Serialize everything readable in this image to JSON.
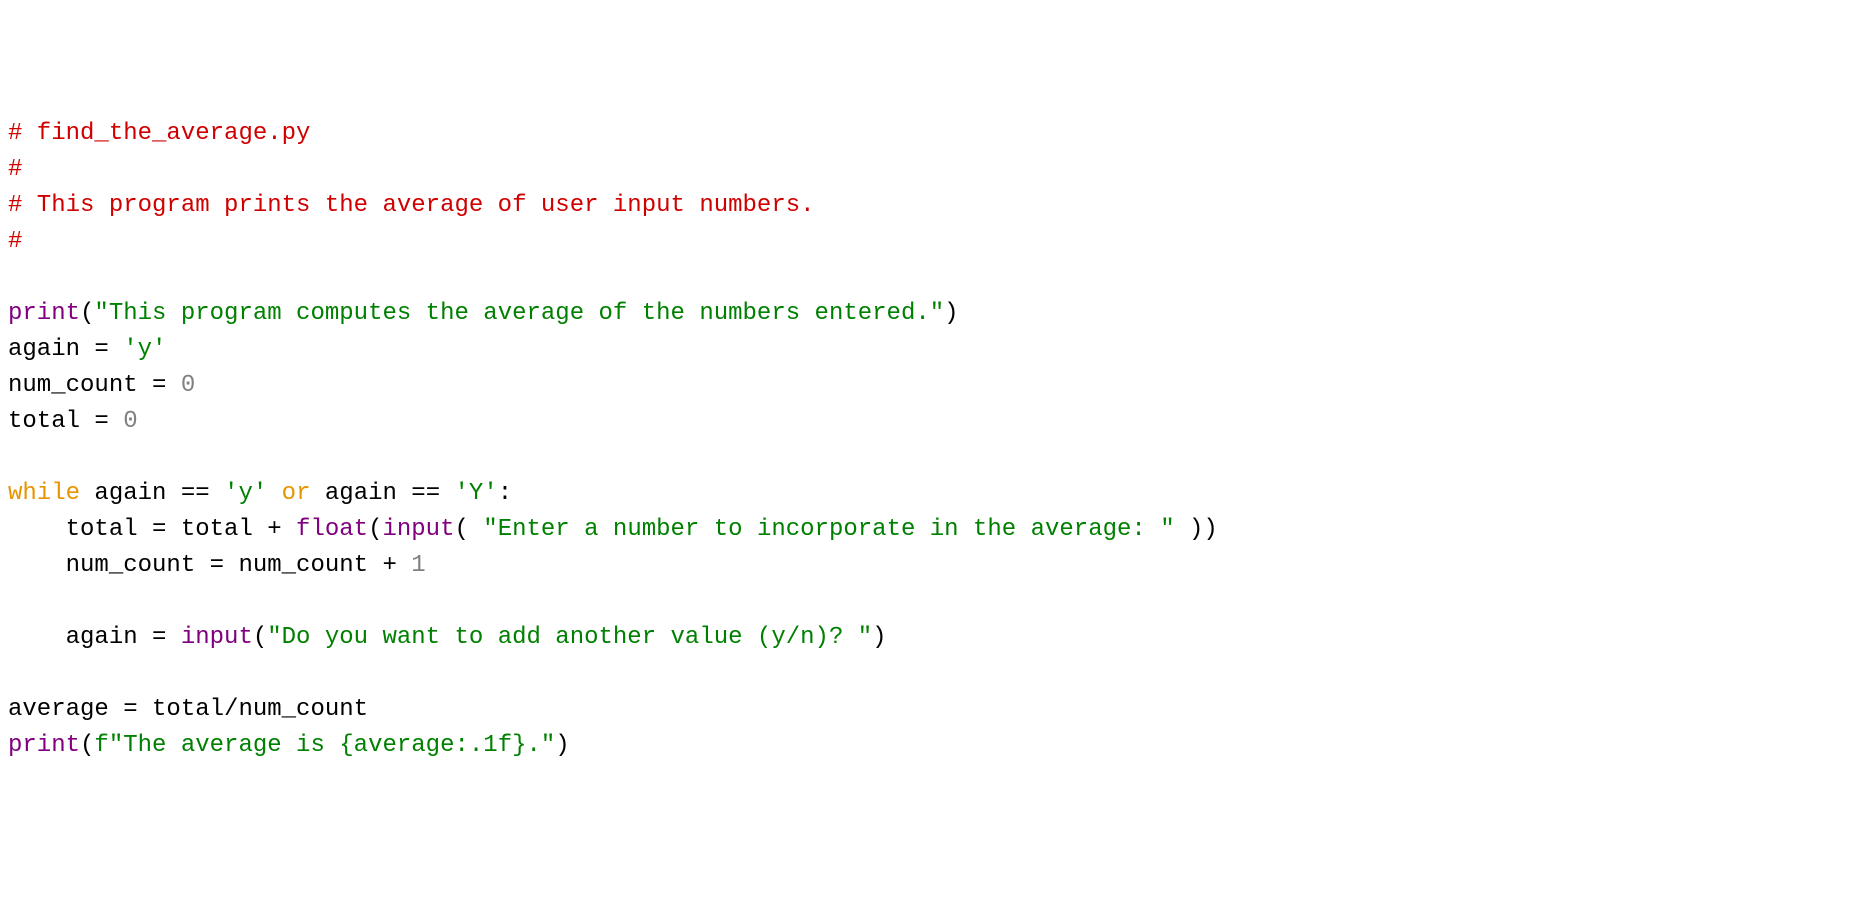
{
  "code": {
    "lines": [
      [
        {
          "cls": "c-comment",
          "text": "# find_the_average.py"
        }
      ],
      [
        {
          "cls": "c-comment",
          "text": "#"
        }
      ],
      [
        {
          "cls": "c-comment",
          "text": "# This program prints the average of user input numbers."
        }
      ],
      [
        {
          "cls": "c-comment",
          "text": "#"
        }
      ],
      [
        {
          "cls": "c-default",
          "text": ""
        }
      ],
      [
        {
          "cls": "c-builtin",
          "text": "print"
        },
        {
          "cls": "c-default",
          "text": "("
        },
        {
          "cls": "c-string",
          "text": "\"This program computes the average of the numbers entered.\""
        },
        {
          "cls": "c-default",
          "text": ")"
        }
      ],
      [
        {
          "cls": "c-default",
          "text": "again = "
        },
        {
          "cls": "c-string",
          "text": "'y'"
        }
      ],
      [
        {
          "cls": "c-default",
          "text": "num_count = "
        },
        {
          "cls": "c-number",
          "text": "0"
        }
      ],
      [
        {
          "cls": "c-default",
          "text": "total = "
        },
        {
          "cls": "c-number",
          "text": "0"
        }
      ],
      [
        {
          "cls": "c-default",
          "text": ""
        }
      ],
      [
        {
          "cls": "c-keyword",
          "text": "while"
        },
        {
          "cls": "c-default",
          "text": " again == "
        },
        {
          "cls": "c-string",
          "text": "'y'"
        },
        {
          "cls": "c-default",
          "text": " "
        },
        {
          "cls": "c-keyword",
          "text": "or"
        },
        {
          "cls": "c-default",
          "text": " again == "
        },
        {
          "cls": "c-string",
          "text": "'Y'"
        },
        {
          "cls": "c-default",
          "text": ":"
        }
      ],
      [
        {
          "cls": "c-default",
          "text": "    total = total + "
        },
        {
          "cls": "c-builtin",
          "text": "float"
        },
        {
          "cls": "c-default",
          "text": "("
        },
        {
          "cls": "c-builtin",
          "text": "input"
        },
        {
          "cls": "c-default",
          "text": "( "
        },
        {
          "cls": "c-string",
          "text": "\"Enter a number to incorporate in the average: \""
        },
        {
          "cls": "c-default",
          "text": " ))"
        }
      ],
      [
        {
          "cls": "c-default",
          "text": "    num_count = num_count + "
        },
        {
          "cls": "c-number",
          "text": "1"
        }
      ],
      [
        {
          "cls": "c-default",
          "text": ""
        }
      ],
      [
        {
          "cls": "c-default",
          "text": "    again = "
        },
        {
          "cls": "c-builtin",
          "text": "input"
        },
        {
          "cls": "c-default",
          "text": "("
        },
        {
          "cls": "c-string",
          "text": "\"Do you want to add another value (y/n)? \""
        },
        {
          "cls": "c-default",
          "text": ")"
        }
      ],
      [
        {
          "cls": "c-default",
          "text": ""
        }
      ],
      [
        {
          "cls": "c-default",
          "text": "average = total/num_count"
        }
      ],
      [
        {
          "cls": "c-builtin",
          "text": "print"
        },
        {
          "cls": "c-default",
          "text": "("
        },
        {
          "cls": "c-string",
          "text": "f\"The average is {average:.1f}.\""
        },
        {
          "cls": "c-default",
          "text": ")"
        }
      ]
    ]
  }
}
